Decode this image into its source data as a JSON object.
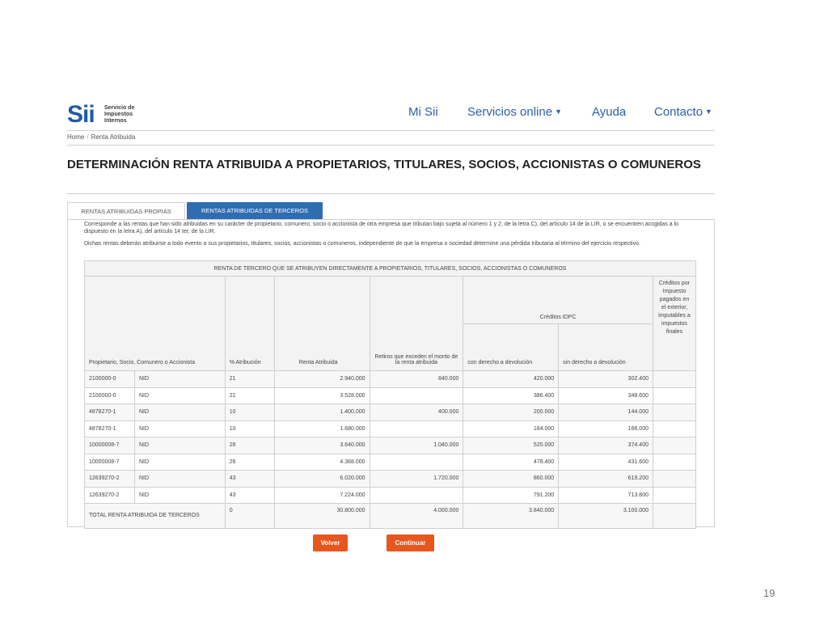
{
  "header": {
    "logo_mark": "Sii",
    "logo_text": [
      "Servicio de",
      "Impuestos",
      "Internos"
    ],
    "nav": {
      "mi_sii": "Mi Sii",
      "servicios": "Servicios online",
      "ayuda": "Ayuda",
      "contacto": "Contacto"
    }
  },
  "breadcrumb": {
    "home": "Home",
    "separator": "/",
    "current": "Renta Atribuida"
  },
  "page_title": "DETERMINACIÓN RENTA ATRIBUIDA A PROPIETARIOS, TITULARES, SOCIOS, ACCIONISTAS O COMUNEROS",
  "tabs": {
    "propias": "RENTAS ATRIBUIDAS PROPIAS",
    "terceros": "RENTAS ATRIBUIDAS DE TERCEROS"
  },
  "intro": {
    "p1": "Corresponde a las rentas que han sido atribuidas en su carácter de propietario, comunero, socio o accionista de otra empresa que tributan bajo sujeta al número 1 y 2, de la letra C), del artículo 14 de la LIR, o se encuentren acogidas a lo dispuesto en la letra A), del artículo 14 ter, de la LIR.",
    "p2": "Dichas rentas deberán atribuirse a todo evento a sus propietarios, titulares, socios, accionistas o comuneros, independiente de que la empresa o sociedad determine una pérdida tributaria al término del ejercicio respectivo."
  },
  "table": {
    "title": "RENTA DE TERCERO QUE SE ATRIBUYEN DIRECTAMENTE A PROPIETARIOS, TITULARES, SOCIOS, ACCIONISTAS O COMUNEROS",
    "headers": {
      "propietario": "Propietario, Socio, Comunero o Accionista",
      "atribucion": "% Atribución",
      "renta": "Renta Atribuida",
      "retiros": "Retiros que exceden el monto de la renta atribuida",
      "creditos_idpc": "Créditos IDPC",
      "con_derecho": "con derecho a devolución",
      "sin_derecho": "sin derecho a devolución",
      "creditos_exterior": "Créditos por Impuesto pagados en el exterior, imputables a impuestos finales"
    },
    "rows": [
      {
        "rut": "2100000-0",
        "tipo": "NID",
        "pct": "21",
        "renta": "2.940.000",
        "retiros": "840.000",
        "con": "420.000",
        "sin": "302.400"
      },
      {
        "rut": "2100000-0",
        "tipo": "NID",
        "pct": "21",
        "renta": "3.528.000",
        "retiros": "",
        "con": "386.400",
        "sin": "348.600"
      },
      {
        "rut": "4878270-1",
        "tipo": "NID",
        "pct": "10",
        "renta": "1.400.000",
        "retiros": "400.000",
        "con": "200.000",
        "sin": "144.000"
      },
      {
        "rut": "4878270-1",
        "tipo": "NID",
        "pct": "10",
        "renta": "1.680.000",
        "retiros": "",
        "con": "184.000",
        "sin": "166.000"
      },
      {
        "rut": "10000008-7",
        "tipo": "NID",
        "pct": "26",
        "renta": "3.640.000",
        "retiros": "1.040.000",
        "con": "520.000",
        "sin": "374.400"
      },
      {
        "rut": "10000008-7",
        "tipo": "NID",
        "pct": "26",
        "renta": "4.368.000",
        "retiros": "",
        "con": "478.400",
        "sin": "431.600"
      },
      {
        "rut": "12639270-2",
        "tipo": "NID",
        "pct": "43",
        "renta": "6.020.000",
        "retiros": "1.720.000",
        "con": "860.000",
        "sin": "619.200"
      },
      {
        "rut": "12639270-2",
        "tipo": "NID",
        "pct": "43",
        "renta": "7.224.000",
        "retiros": "",
        "con": "791.200",
        "sin": "713.800"
      }
    ],
    "total": {
      "label": "TOTAL RENTA ATRIBUIDA DE TERCEROS",
      "pct": "0",
      "renta": "30.800.000",
      "retiros": "4.000.000",
      "con": "3.840.000",
      "sin": "3.100.000"
    }
  },
  "buttons": {
    "volver": "Volver",
    "continuar": "Continuar"
  },
  "page_number": "19",
  "colors": {
    "brand_blue": "#1f5aa8",
    "tab_active": "#2f6db1",
    "button_orange": "#e8561f"
  }
}
